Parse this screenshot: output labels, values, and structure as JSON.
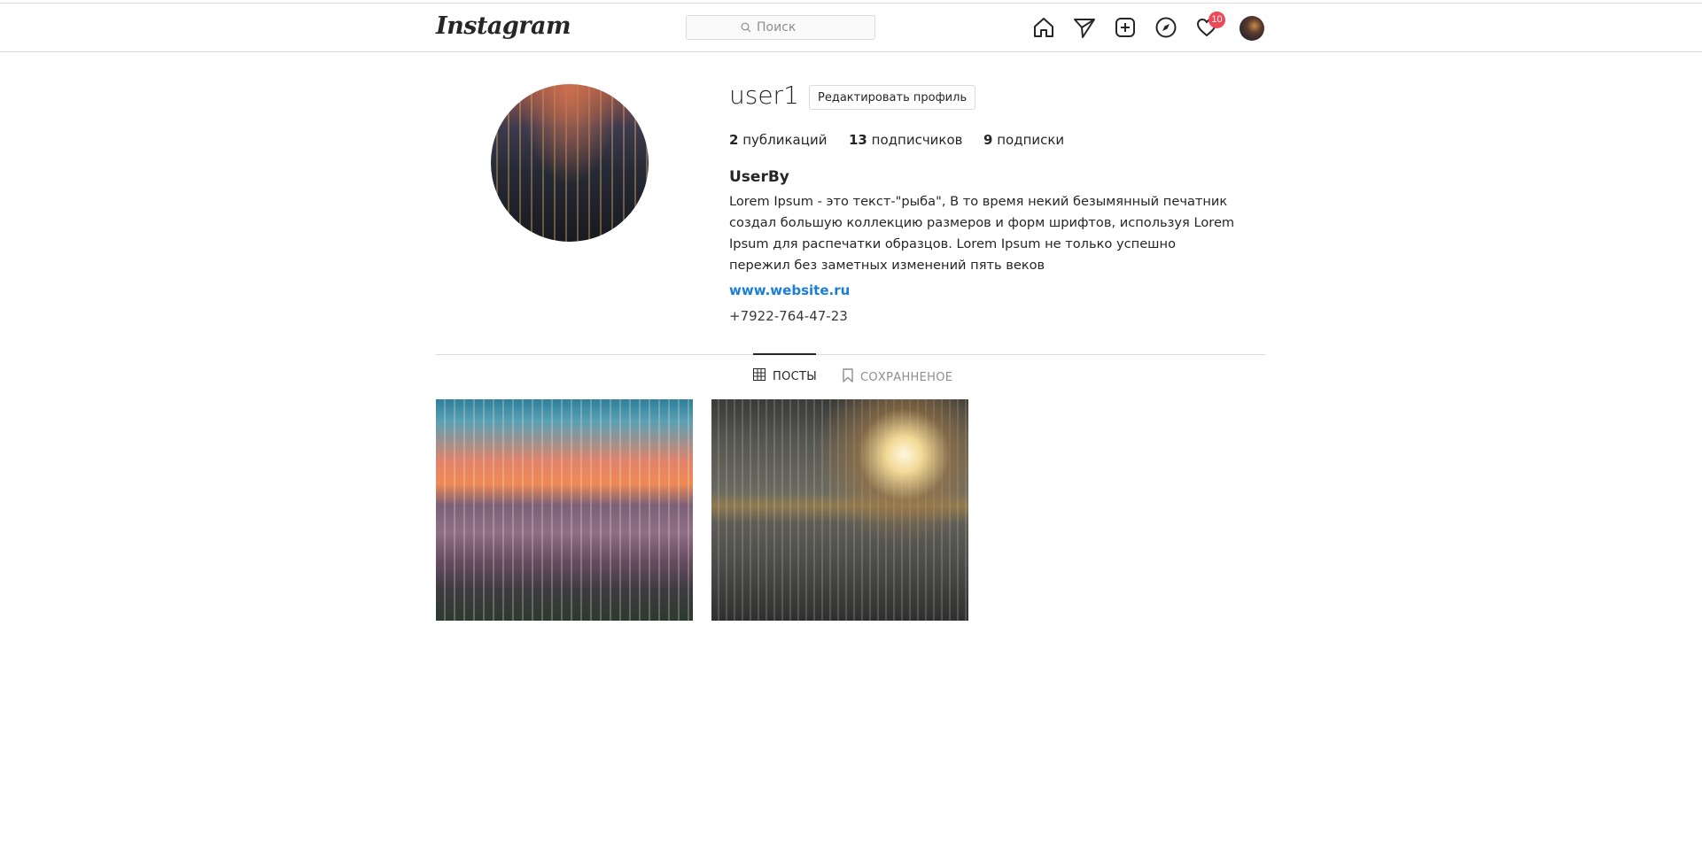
{
  "header": {
    "logo": "Instagram",
    "search_placeholder": "Поиск",
    "notifications_count": "10",
    "nav_icons": [
      "home-icon",
      "send-icon",
      "add-post-icon",
      "explore-icon",
      "heart-icon"
    ]
  },
  "profile": {
    "username": "user1",
    "edit_button": "Редактировать профиль",
    "stats": [
      {
        "count": "2",
        "label": "публикаций"
      },
      {
        "count": "13",
        "label": "подписчиков"
      },
      {
        "count": "9",
        "label": "подписки"
      }
    ],
    "display_name": "UserBy",
    "bio": "Lorem Ipsum - это текст-\"рыба\", В то время некий безымянный печатник создал большую коллекцию размеров и форм шрифтов, используя Lorem Ipsum для распечатки образцов. Lorem Ipsum не только успешно пережил без заметных изменений пять веков",
    "website": "www.website.ru",
    "phone": "+7922-764-47-23"
  },
  "tabs": [
    {
      "label": "ПОСТЫ",
      "icon": "grid-icon",
      "active": true
    },
    {
      "label": "СОХРАННЕНОЕ",
      "icon": "bookmark-icon",
      "active": false
    }
  ],
  "colors": {
    "accent_link": "#1a7ed6",
    "badge": "#ed4956",
    "border": "#dbdbdb"
  }
}
